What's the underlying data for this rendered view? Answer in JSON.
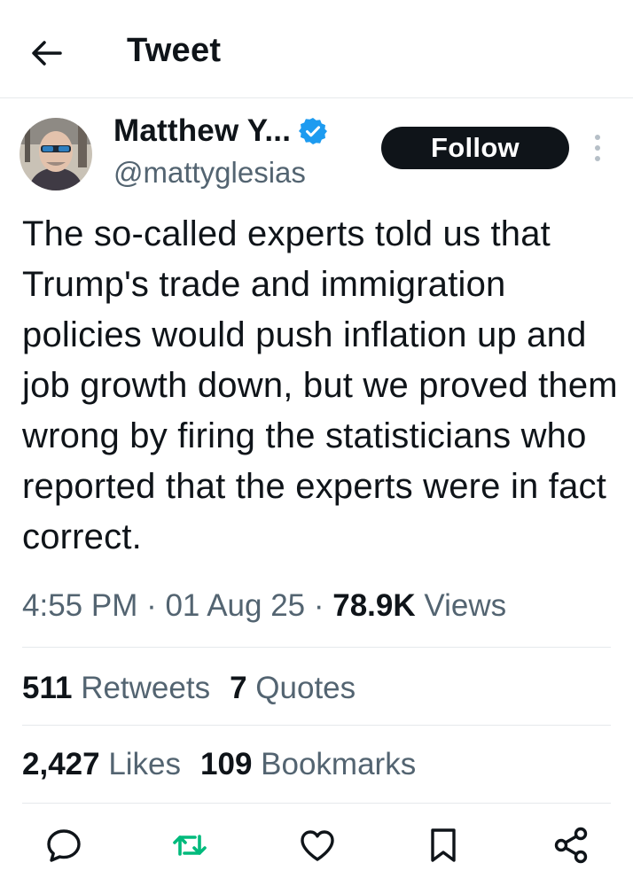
{
  "header": {
    "title": "Tweet",
    "back_icon": "arrow-left-icon"
  },
  "author": {
    "name": "Matthew Y...",
    "handle": "@mattyglesias",
    "verified_color": "#1d9bf0"
  },
  "follow_label": "Follow",
  "tweet": {
    "text": "The so-called experts told us that Trump's trade and immigration policies would push inflation up and job growth down, but we proved them wrong by firing the statisticians who reported that the experts were in fact correct."
  },
  "meta": {
    "time": "4:55 PM",
    "sep1": " · ",
    "date": "01 Aug 25",
    "sep2": " · ",
    "views_count": "78.9K",
    "views_label": " Views"
  },
  "stats": {
    "retweets_count": "511",
    "retweets_label": " Retweets",
    "quotes_count": "7",
    "quotes_label": " Quotes",
    "likes_count": "2,427",
    "likes_label": " Likes",
    "bookmarks_count": "109",
    "bookmarks_label": " Bookmarks"
  },
  "actions": [
    "reply-icon",
    "retweet-icon",
    "like-icon",
    "bookmark-icon",
    "share-icon"
  ],
  "colors": {
    "retweet_green": "#00ba7c",
    "muted": "#536471",
    "text": "#0f1419"
  }
}
